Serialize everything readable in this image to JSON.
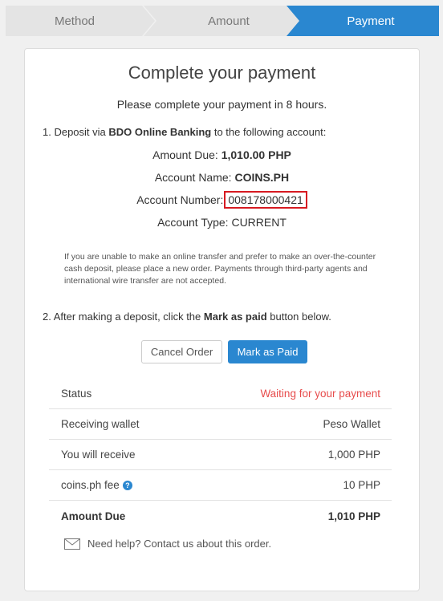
{
  "stepper": {
    "steps": [
      {
        "label": "Method",
        "active": false
      },
      {
        "label": "Amount",
        "active": false
      },
      {
        "label": "Payment",
        "active": true
      }
    ]
  },
  "card": {
    "title": "Complete your payment",
    "subtitle": "Please complete your payment in 8 hours.",
    "step1": {
      "prefix": "1. Deposit via ",
      "bank": "BDO Online Banking",
      "suffix": " to the following account:"
    },
    "account": {
      "amount_due_label": "Amount Due: ",
      "amount_due_value": "1,010.00 PHP",
      "name_label": "Account Name: ",
      "name_value": "COINS.PH",
      "number_label": "Account Number:",
      "number_value": "008178000421",
      "type_label": "Account Type: ",
      "type_value": "CURRENT"
    },
    "note": "If you are unable to make an online transfer and prefer to make an over-the-counter cash deposit, please place a new order. Payments through third-party agents and international wire transfer are not accepted.",
    "step2": {
      "prefix": "2. After making a deposit, click the ",
      "bold": "Mark as paid",
      "suffix": " button below."
    },
    "buttons": {
      "cancel": "Cancel Order",
      "mark_paid": "Mark as Paid"
    },
    "summary": [
      {
        "label": "Status",
        "value": "Waiting for your payment"
      },
      {
        "label": "Receiving wallet",
        "value": "Peso Wallet"
      },
      {
        "label": "You will receive",
        "value": "1,000 PHP"
      },
      {
        "label": "coins.ph fee",
        "value": "10 PHP"
      },
      {
        "label": "Amount Due",
        "value": "1,010 PHP"
      }
    ],
    "help_icon_glyph": "?",
    "footer": "Need help? Contact us about this order."
  },
  "colors": {
    "accent": "#2a87d0",
    "waiting": "#e74c4c",
    "highlight_border": "#d71a21"
  }
}
